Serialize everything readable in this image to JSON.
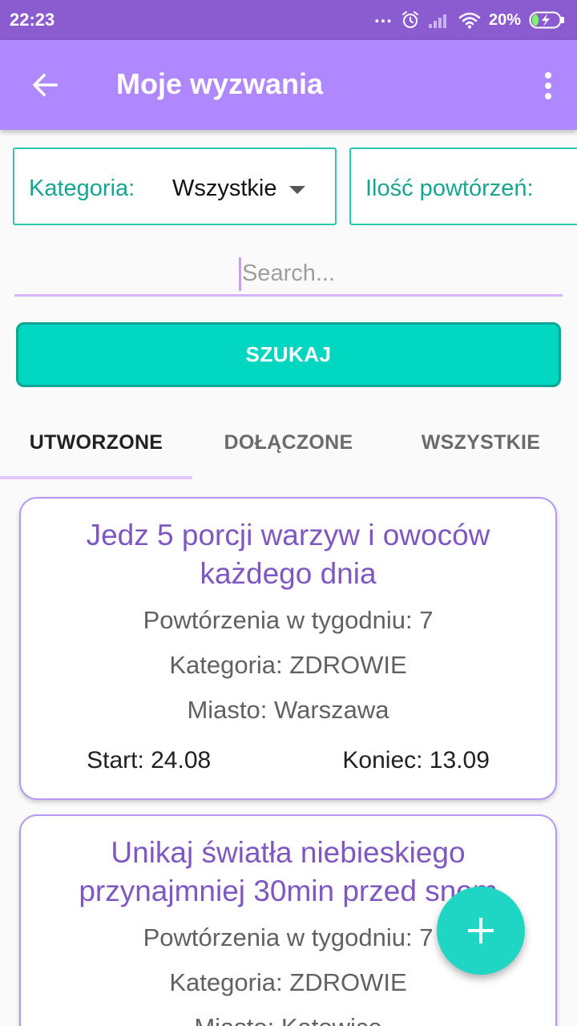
{
  "status_bar": {
    "time": "22:23",
    "dots": "...",
    "battery_percent": "20%"
  },
  "app_bar": {
    "title": "Moje wyzwania"
  },
  "filters": {
    "category_label": "Kategoria:",
    "category_value": "Wszystkie",
    "repetitions_label": "Ilość powtórzeń:"
  },
  "search": {
    "placeholder": "Search...",
    "value": ""
  },
  "search_button": {
    "label": "SZUKAJ"
  },
  "tabs": [
    {
      "label": "UTWORZONE",
      "active": true
    },
    {
      "label": "DOŁĄCZONE",
      "active": false
    },
    {
      "label": "WSZYSTKIE",
      "active": false
    }
  ],
  "challenges": [
    {
      "title": "Jedz 5 porcji warzyw i owoców każdego dnia",
      "repetitions": "Powtórzenia w tygodniu: 7",
      "category": "Kategoria: ZDROWIE",
      "city": "Miasto: Warszawa",
      "start": "Start: 24.08",
      "end": "Koniec: 13.09"
    },
    {
      "title": "Unikaj światła niebieskiego przynajmniej 30min przed snem",
      "repetitions": "Powtórzenia w tygodniu: 7",
      "category": "Kategoria: ZDROWIE",
      "city": "Miasto: Katowice"
    }
  ],
  "icons": {
    "back": "arrow-back-icon",
    "menu": "more-vert-icon",
    "fab": "plus-icon"
  },
  "colors": {
    "status_bar": "#8a5cd0",
    "app_bar": "#af87ff",
    "accent": "#00d6c0",
    "card_title": "#7e57c2",
    "filter_label": "#17a592"
  }
}
